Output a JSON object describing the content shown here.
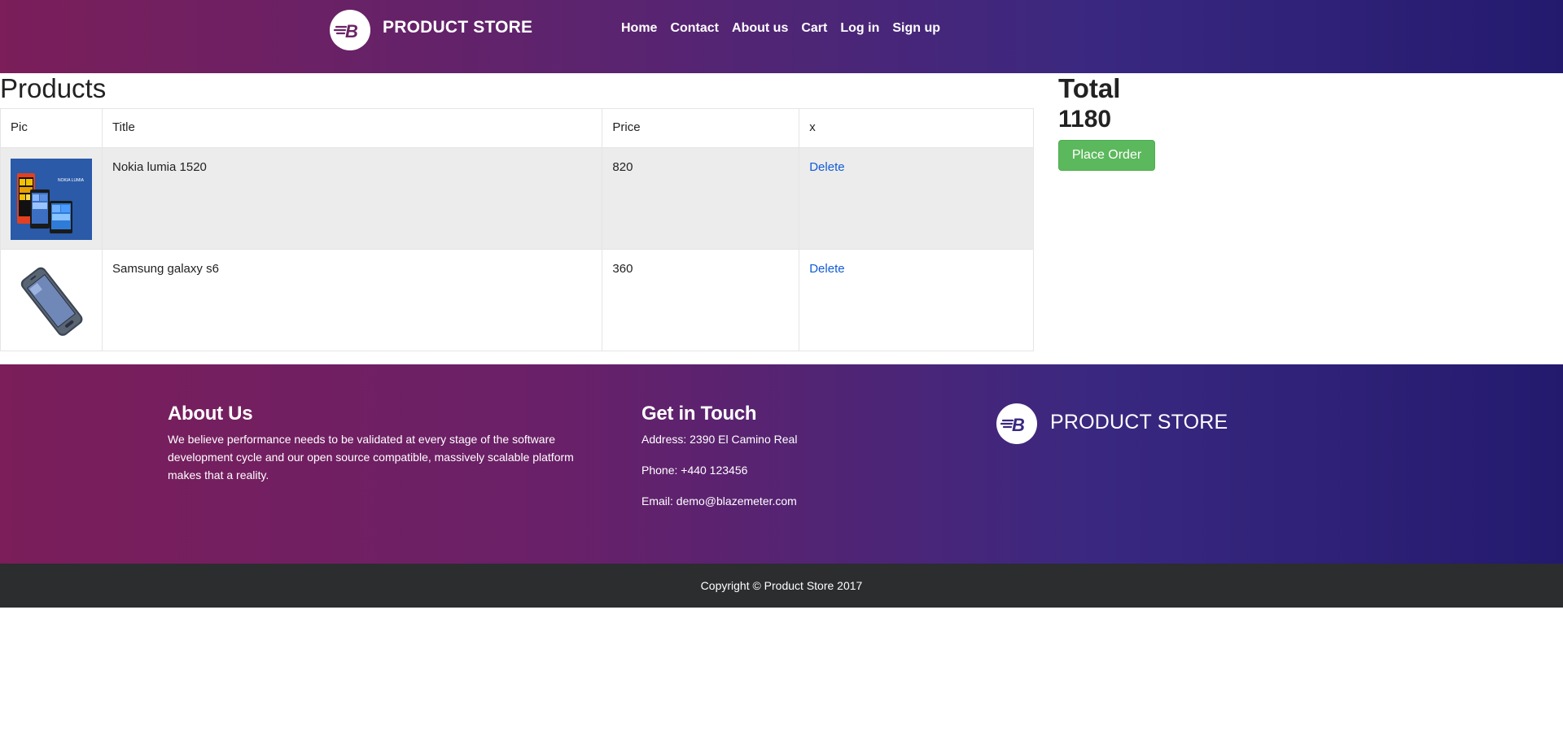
{
  "header": {
    "brand": "PRODUCT STORE",
    "nav": [
      "Home",
      "Contact",
      "About us",
      "Cart",
      "Log in",
      "Sign up"
    ]
  },
  "products": {
    "title": "Products",
    "columns": [
      "Pic",
      "Title",
      "Price",
      "x"
    ],
    "rows": [
      {
        "title": "Nokia lumia 1520",
        "price": "820",
        "action": "Delete"
      },
      {
        "title": "Samsung galaxy s6",
        "price": "360",
        "action": "Delete"
      }
    ]
  },
  "total": {
    "label": "Total",
    "value": "1180",
    "place_order": "Place Order"
  },
  "footer": {
    "about_heading": "About Us",
    "about_text": "We believe performance needs to be validated at every stage of the software development cycle and our open source compatible, massively scalable platform makes that a reality.",
    "contact_heading": "Get in Touch",
    "address": "Address: 2390 El Camino Real",
    "phone": "Phone: +440 123456",
    "email": "Email: demo@blazemeter.com",
    "brand": "PRODUCT STORE",
    "copyright": "Copyright © Product Store 2017"
  },
  "colors": {
    "brand_purple": "#7b1e5a",
    "brand_indigo": "#231a6e",
    "link_blue": "#0f5bd8",
    "button_green": "#5cb85c",
    "footer_dark": "#2b2d2f"
  },
  "icons": {
    "logo": "blazemeter-b-logo-icon",
    "product_1": "nokia-lumia-phone-image",
    "product_2": "samsung-galaxy-phone-image"
  }
}
